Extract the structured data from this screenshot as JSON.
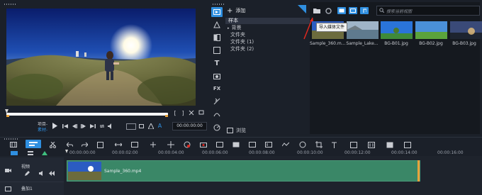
{
  "colors": {
    "accent": "#2f8fe0",
    "clip": "#3a8767",
    "playhead": "#e8a23c",
    "bg": "#1b2029"
  },
  "preview": {
    "project_label": "项目-",
    "clip_label": "素材-",
    "timecode": "00:00:00:00",
    "play_icon": "play-icon"
  },
  "library": {
    "add_label": "添加",
    "tree": [
      "样本",
      "背景",
      "文件夹",
      "文件夹 (1)",
      "文件夹 (2)"
    ],
    "browse_label": "浏览",
    "search_placeholder": "搜索当前视图",
    "tooltip": "导入媒体文件",
    "thumbnails": [
      "Sample_360.m...",
      "Sample_Lake...",
      "BG-B01.jpg",
      "BG-B02.jpg",
      "BG-B03.jpg"
    ]
  },
  "timeline": {
    "ticks": [
      "00:00:00:00",
      "00:00:02:00",
      "00:00:04:00",
      "00:00:06:00",
      "00:00:08:00",
      "00:00:10:00",
      "00:00:12:00",
      "00:00:14:00",
      "00:00:16:00"
    ],
    "tracks": [
      {
        "name": "视频"
      },
      {
        "name": "叠加1"
      }
    ],
    "clip_name": "Sample_360.mp4"
  }
}
